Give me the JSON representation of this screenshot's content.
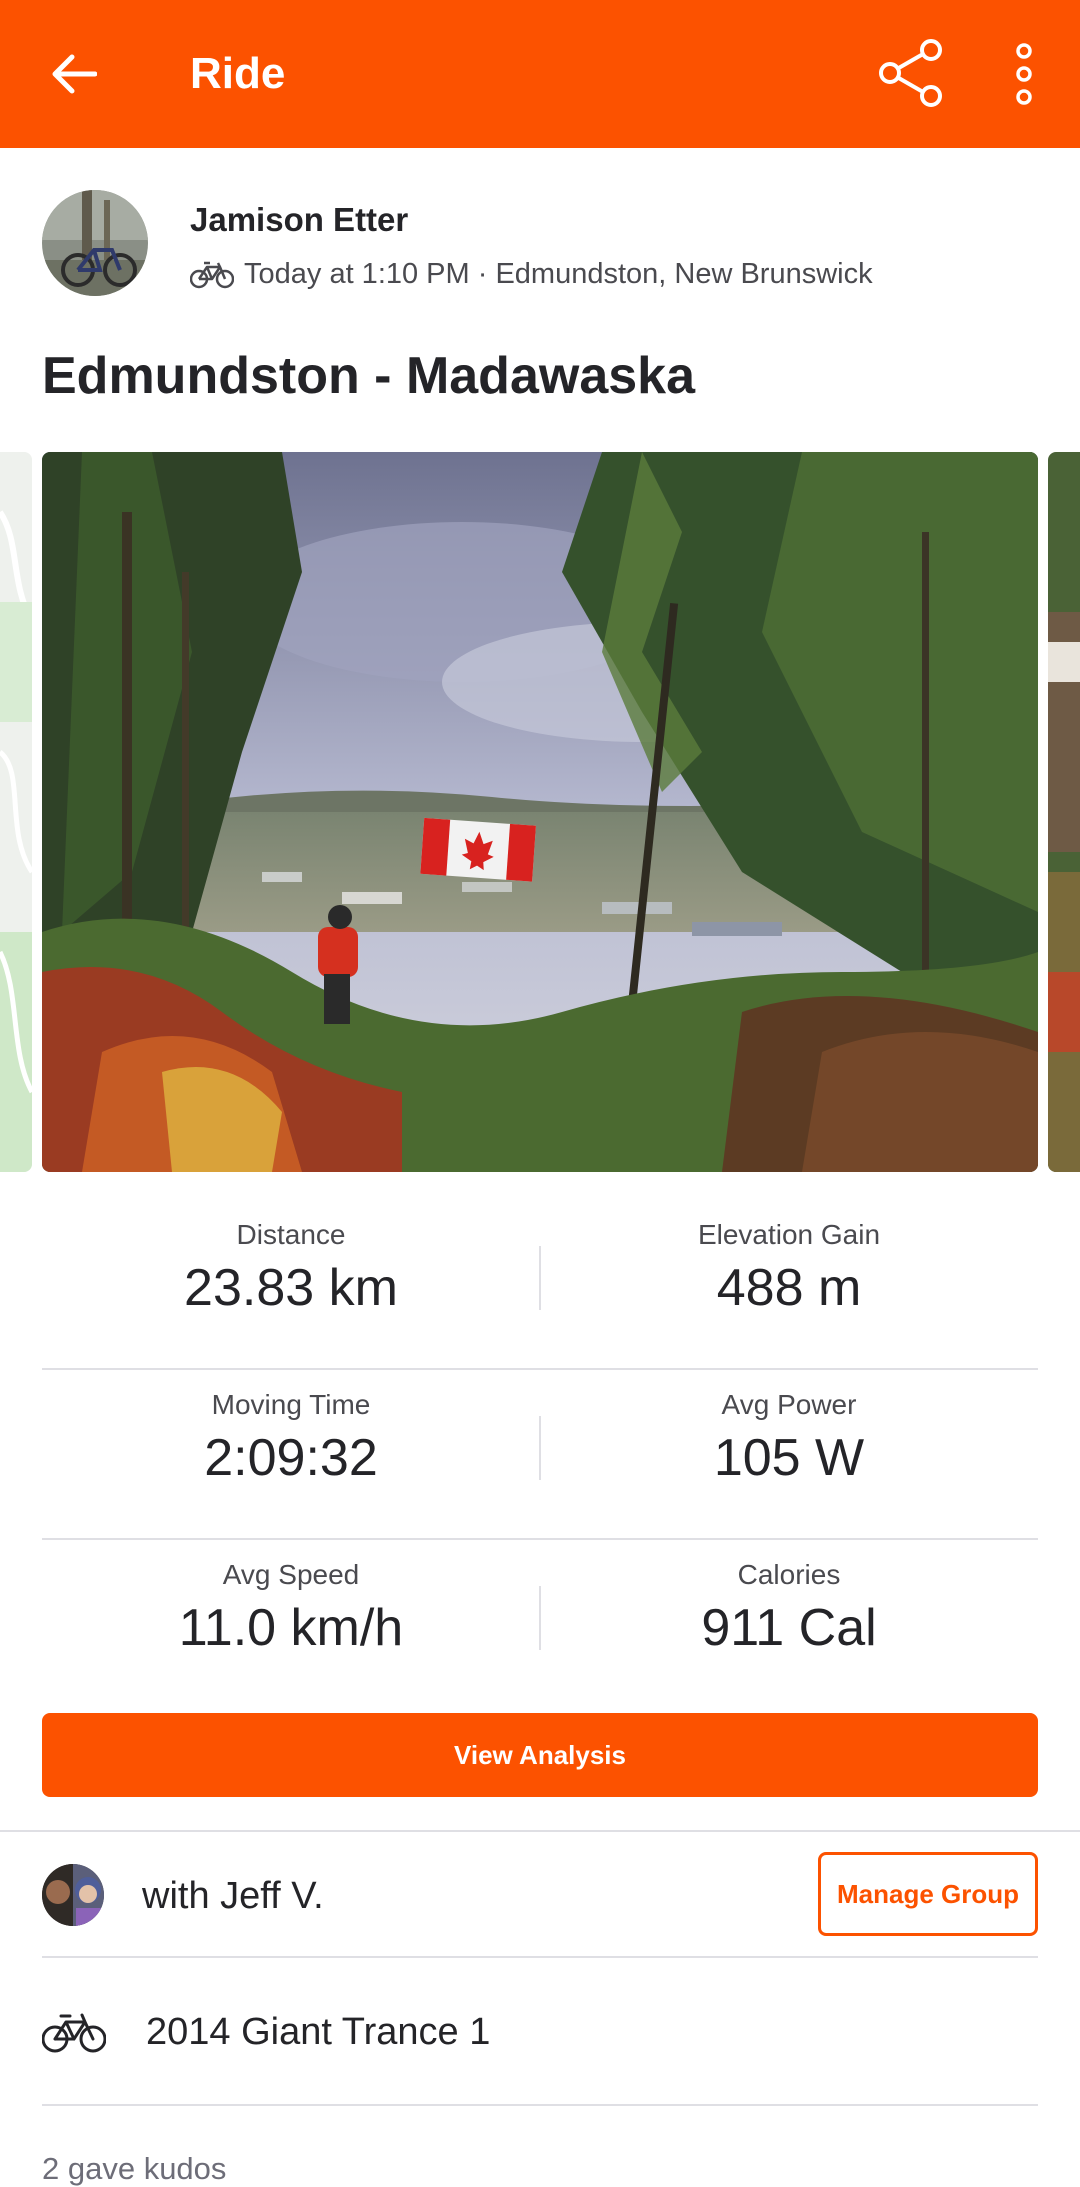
{
  "app_bar": {
    "title": "Ride",
    "background_color": "#fc5200",
    "icons": [
      "back-arrow-icon",
      "share-icon",
      "more-vert-icon"
    ]
  },
  "athlete": {
    "name": "Jamison Etter",
    "meta": "Today at 1:10 PM · Edmundston, New Brunswick",
    "sport_icon": "bike-icon"
  },
  "activity": {
    "title": "Edmundston - Madawaska"
  },
  "stats": [
    {
      "label": "Distance",
      "value": "23.83 km"
    },
    {
      "label": "Elevation Gain",
      "value": "488 m"
    },
    {
      "label": "Moving Time",
      "value": "2:09:32"
    },
    {
      "label": "Avg Power",
      "value": "105 W"
    },
    {
      "label": "Avg Speed",
      "value": "11.0 km/h"
    },
    {
      "label": "Calories",
      "value": "911 Cal"
    }
  ],
  "actions": {
    "view_analysis": "View Analysis",
    "manage_group": "Manage Group"
  },
  "group": {
    "text": "with Jeff V."
  },
  "gear": {
    "name": "2014 Giant Trance 1",
    "icon": "bike-icon"
  },
  "kudos": {
    "text": "2 gave kudos"
  },
  "colors": {
    "accent": "#fc5200",
    "text_primary": "#242428",
    "text_secondary": "#4a4a4f",
    "divider": "#dfdfe4"
  }
}
